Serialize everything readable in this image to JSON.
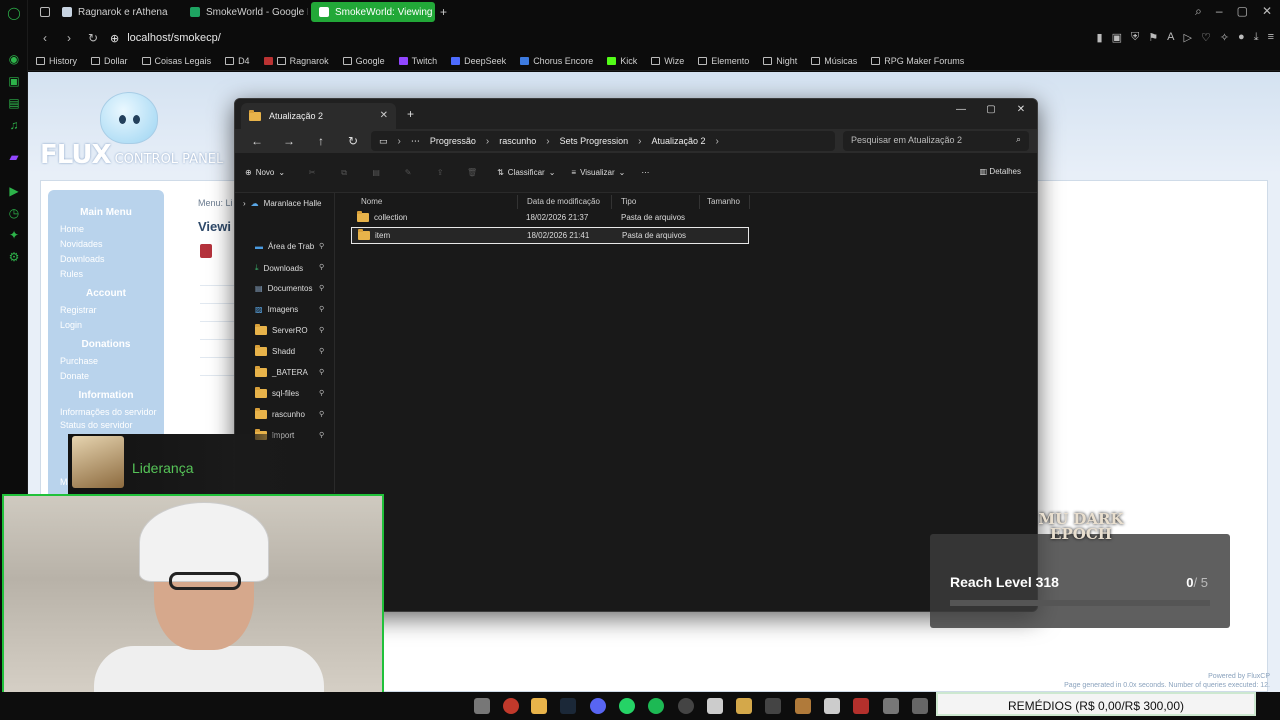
{
  "browser": {
    "tabs": [
      {
        "label": "Ragnarok e rAthena",
        "active": false
      },
      {
        "label": "SmokeWorld - Google Pla",
        "active": false
      },
      {
        "label": "SmokeWorld: Viewing Item",
        "active": true
      }
    ],
    "url": "localhost/smokecp/",
    "bookmarks": [
      "History",
      "Dollar",
      "Coisas Legais",
      "D4",
      "Ragnarok",
      "Google",
      "Twitch",
      "DeepSeek",
      "Chorus Encore",
      "Kick",
      "Wize",
      "Elemento",
      "Night",
      "Músicas",
      "RPG Maker Forums"
    ],
    "accent": "#22a838"
  },
  "flux": {
    "logo": "FLUX",
    "logo_sub": "CONTROL PANEL",
    "menu": [
      {
        "heading": "Main Menu",
        "items": [
          "Home",
          "Novidades",
          "Downloads",
          "Rules"
        ]
      },
      {
        "heading": "Account",
        "items": [
          "Registrar",
          "Login"
        ]
      },
      {
        "heading": "Donations",
        "items": [
          "Purchase",
          "Donate"
        ]
      },
      {
        "heading": "Information",
        "items": [
          "Informações do servidor",
          "Status do servidor",
          "Map Statics"
        ]
      }
    ],
    "breadcrumb_stub": "Menu: Li",
    "title_stub": "Viewi",
    "powered_by": "Powered by FluxCP",
    "footer_line": "Page generated in 0.0x seconds. Number of queries executed: 12."
  },
  "explorer": {
    "tab_title": "Atualização 2",
    "breadcrumbs": [
      "Progressão",
      "rascunho",
      "Sets Progression",
      "Atualização 2"
    ],
    "search_placeholder": "Pesquisar em Atualização 2",
    "toolbar": {
      "new": "Novo",
      "sort": "Classificar",
      "view": "Visualizar",
      "details": "Detalhes"
    },
    "nav_pane": [
      "Maranlace Halle",
      "Área de Trab",
      "Downloads",
      "Documentos",
      "Imagens",
      "ServerRO",
      "Shadd",
      "_BATERA",
      "sql-files",
      "rascunho",
      "import"
    ],
    "columns": [
      "Nome",
      "Data de modificação",
      "Tipo",
      "Tamanho"
    ],
    "files": [
      {
        "name": "collection",
        "date": "18/02/2026 21:37",
        "type": "Pasta de arquivos",
        "selected": false
      },
      {
        "name": "item",
        "date": "18/02/2026 21:41",
        "type": "Pasta de arquivos",
        "selected": true
      }
    ]
  },
  "overlays": {
    "notification": "Liderança",
    "achievement": {
      "game": "MU DARK EPOCH",
      "title": "Reach Level 318",
      "progress": 0,
      "total": 5,
      "total_label": "/ 5",
      "progress_label": "0"
    }
  },
  "taskbar": {
    "goal_banner": "REMÉDIOS (R$ 0,00/R$ 300,00)"
  }
}
